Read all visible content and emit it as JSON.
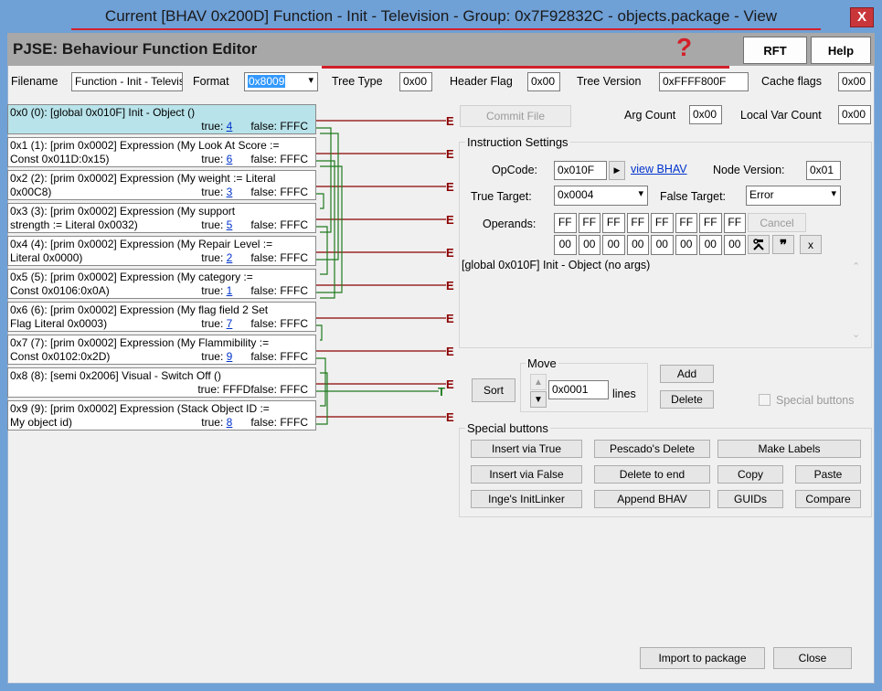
{
  "window": {
    "title": "Current [BHAV 0x200D] Function - Init - Television - Group: 0x7F92832C - objects.package - View",
    "close_glyph": "X"
  },
  "header": {
    "title": "PJSE: Behaviour Function Editor",
    "annotation_mark": "?",
    "rft_label": "RFT",
    "help_label": "Help"
  },
  "topfields": {
    "filename_label": "Filename",
    "filename_value": "Function - Init - Television",
    "format_label": "Format",
    "format_value": "0x8009",
    "tree_type_label": "Tree Type",
    "tree_type_value": "0x00",
    "header_flag_label": "Header Flag",
    "header_flag_value": "0x00",
    "tree_version_label": "Tree Version",
    "tree_version_value": "0xFFFF800F",
    "cache_flags_label": "Cache flags",
    "cache_flags_value": "0x00"
  },
  "commit": {
    "label": "Commit File",
    "arg_count_label": "Arg Count",
    "arg_count_value": "0x00",
    "local_var_label": "Local Var Count",
    "local_var_value": "0x00"
  },
  "nodes": [
    {
      "line1": "0x0 (0): [global 0x010F] Init - Object ()",
      "line2": "",
      "true_pre": "true: ",
      "true_val": "4",
      "false_text": "false: FFFC",
      "end": "E"
    },
    {
      "line1": "0x1 (1): [prim 0x0002] Expression (My Look At Score :=",
      "line2": "Const 0x011D:0x15)",
      "true_pre": "true: ",
      "true_val": "6",
      "false_text": "false: FFFC",
      "end": "E"
    },
    {
      "line1": "0x2 (2): [prim 0x0002] Expression (My weight := Literal",
      "line2": "0x00C8)",
      "true_pre": "true: ",
      "true_val": "3",
      "false_text": "false: FFFC",
      "end": "E"
    },
    {
      "line1": "0x3 (3): [prim 0x0002] Expression (My support",
      "line2": "strength := Literal 0x0032)",
      "true_pre": "true: ",
      "true_val": "5",
      "false_text": "false: FFFC",
      "end": "E"
    },
    {
      "line1": "0x4 (4): [prim 0x0002] Expression (My Repair Level :=",
      "line2": "Literal 0x0000)",
      "true_pre": "true: ",
      "true_val": "2",
      "false_text": "false: FFFC",
      "end": "E"
    },
    {
      "line1": "0x5 (5): [prim 0x0002] Expression (My category :=",
      "line2": "Const 0x0106:0x0A)",
      "true_pre": "true: ",
      "true_val": "1",
      "false_text": "false: FFFC",
      "end": "E"
    },
    {
      "line1": "0x6 (6): [prim 0x0002] Expression (My flag field 2 Set",
      "line2": "Flag Literal 0x0003)",
      "true_pre": "true: ",
      "true_val": "7",
      "false_text": "false: FFFC",
      "end": "E"
    },
    {
      "line1": "0x7 (7): [prim 0x0002] Expression (My Flammibility :=",
      "line2": "Const 0x0102:0x2D)",
      "true_pre": "true: ",
      "true_val": "9",
      "false_text": "false: FFFC",
      "end": "E"
    },
    {
      "line1": "0x8 (8): [semi 0x2006] Visual - Switch Off ()",
      "line2": "",
      "true_pre": "true: FFFD",
      "true_val": "",
      "false_text": "false: FFFC",
      "end": "E",
      "end2": "T"
    },
    {
      "line1": "0x9 (9): [prim 0x0002] Expression (Stack Object ID :=",
      "line2": "My object id)",
      "true_pre": "true: ",
      "true_val": "8",
      "false_text": "false: FFFC",
      "end": "E"
    }
  ],
  "instruction": {
    "group_label": "Instruction Settings",
    "opcode_label": "OpCode:",
    "opcode_value": "0x010F",
    "view_bhav": "view BHAV",
    "node_version_label": "Node Version:",
    "node_version_value": "0x01",
    "true_target_label": "True Target:",
    "true_target_value": "0x0004",
    "false_target_label": "False Target:",
    "false_target_value": "Error",
    "operands_label": "Operands:",
    "operands_row1": [
      "FF",
      "FF",
      "FF",
      "FF",
      "FF",
      "FF",
      "FF",
      "FF"
    ],
    "operands_row2": [
      "00",
      "00",
      "00",
      "00",
      "00",
      "00",
      "00",
      "00"
    ],
    "cancel_label": "Cancel",
    "quote_glyph": "❞",
    "x_label": "x",
    "description": "[global 0x010F] Init - Object (no args)"
  },
  "move": {
    "sort_label": "Sort",
    "group_label": "Move",
    "value": "0x0001",
    "lines_label": "lines",
    "add_label": "Add",
    "delete_label": "Delete",
    "special_label": "Special buttons"
  },
  "special": {
    "group_label": "Special buttons",
    "buttons": [
      "Insert via True",
      "Pescado's Delete",
      "Make Labels",
      "Insert via False",
      "Delete to end",
      "Copy",
      "Paste",
      "Inge's InitLinker",
      "Append BHAV",
      "GUIDs",
      "Compare"
    ]
  },
  "footer": {
    "import_label": "Import to package",
    "close_label": "Close"
  },
  "colors": {
    "title_bg": "#6fa0d6",
    "selected_node": "#b8e3ea",
    "false_line": "#8b0000",
    "true_line": "#1f7a1f",
    "annotation": "#d3202a"
  }
}
